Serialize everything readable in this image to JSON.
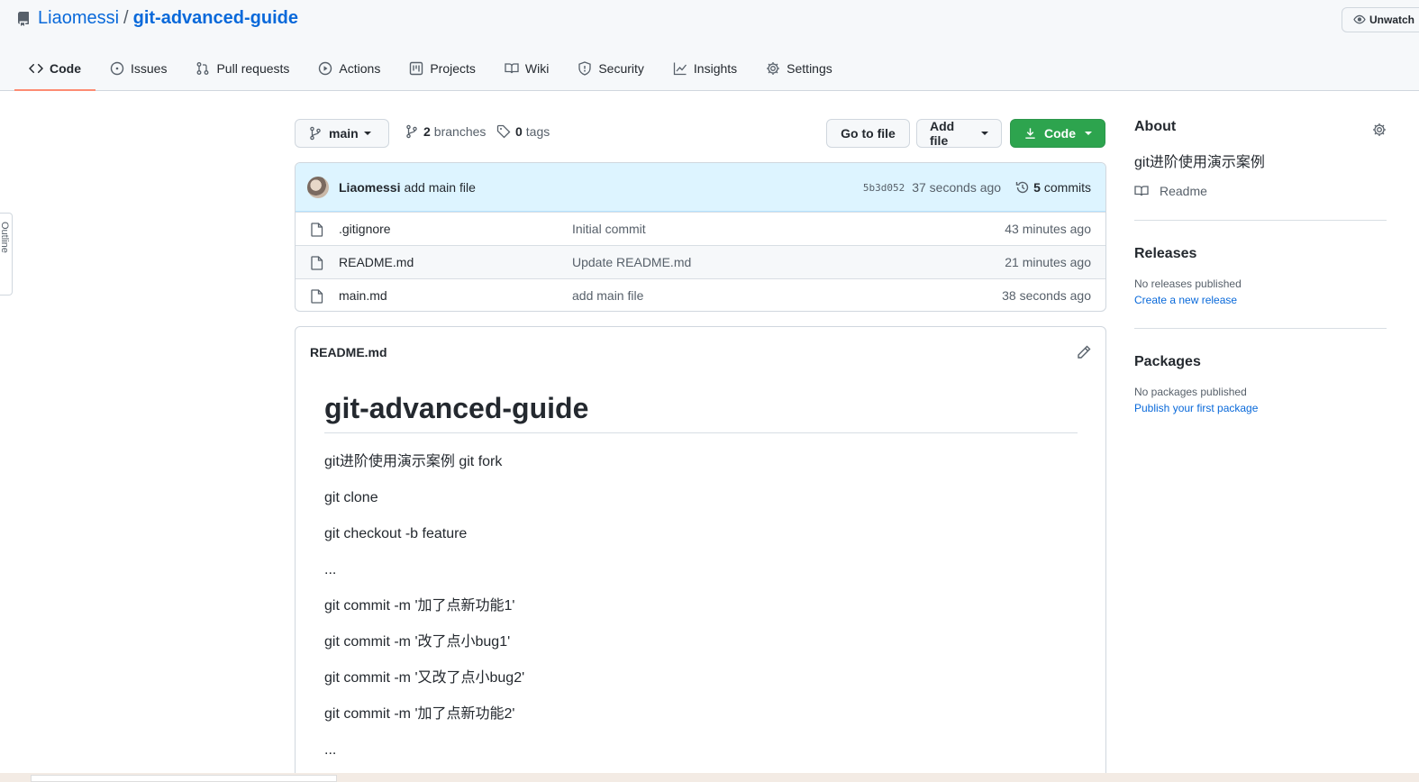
{
  "repo": {
    "owner": "Liaomessi",
    "separator": "/",
    "name": "git-advanced-guide"
  },
  "watch": {
    "label": "Unwatch"
  },
  "nav": [
    {
      "label": "Code",
      "icon": "code-icon",
      "active": true
    },
    {
      "label": "Issues",
      "icon": "issue-icon"
    },
    {
      "label": "Pull requests",
      "icon": "pull-request-icon"
    },
    {
      "label": "Actions",
      "icon": "play-icon"
    },
    {
      "label": "Projects",
      "icon": "project-icon"
    },
    {
      "label": "Wiki",
      "icon": "book-icon"
    },
    {
      "label": "Security",
      "icon": "shield-icon"
    },
    {
      "label": "Insights",
      "icon": "graph-icon"
    },
    {
      "label": "Settings",
      "icon": "gear-icon"
    }
  ],
  "outline": {
    "label": "Outline"
  },
  "toolbar": {
    "branch": "main",
    "branches_count": "2",
    "branches_label": "branches",
    "tags_count": "0",
    "tags_label": "tags",
    "go_to_file": "Go to file",
    "add_file": "Add file",
    "code": "Code"
  },
  "commit": {
    "author": "Liaomessi",
    "message": "add main file",
    "sha": "5b3d052",
    "time": "37 seconds ago",
    "commits_count": "5",
    "commits_label": "commits"
  },
  "files": [
    {
      "name": ".gitignore",
      "message": "Initial commit",
      "time": "43 minutes ago"
    },
    {
      "name": "README.md",
      "message": "Update README.md",
      "time": "21 minutes ago"
    },
    {
      "name": "main.md",
      "message": "add main file",
      "time": "38 seconds ago"
    }
  ],
  "readme": {
    "filename": "README.md",
    "title": "git-advanced-guide",
    "lines": [
      "git进阶使用演示案例 git fork",
      "git clone",
      "git checkout -b feature",
      "...",
      "git commit -m '加了点新功能1'",
      "git commit -m '改了点小bug1'",
      "git commit -m '又改了点小bug2'",
      "git commit -m '加了点新功能2'",
      "..."
    ]
  },
  "sidebar": {
    "about_title": "About",
    "about_desc": "git进阶使用演示案例",
    "readme_label": "Readme",
    "releases_title": "Releases",
    "releases_empty": "No releases published",
    "releases_link": "Create a new release",
    "packages_title": "Packages",
    "packages_empty": "No packages published",
    "packages_link": "Publish your first package"
  },
  "colors": {
    "accent": "#0969da",
    "code_button": "#2da44e",
    "active_tab": "#fd8c73"
  }
}
